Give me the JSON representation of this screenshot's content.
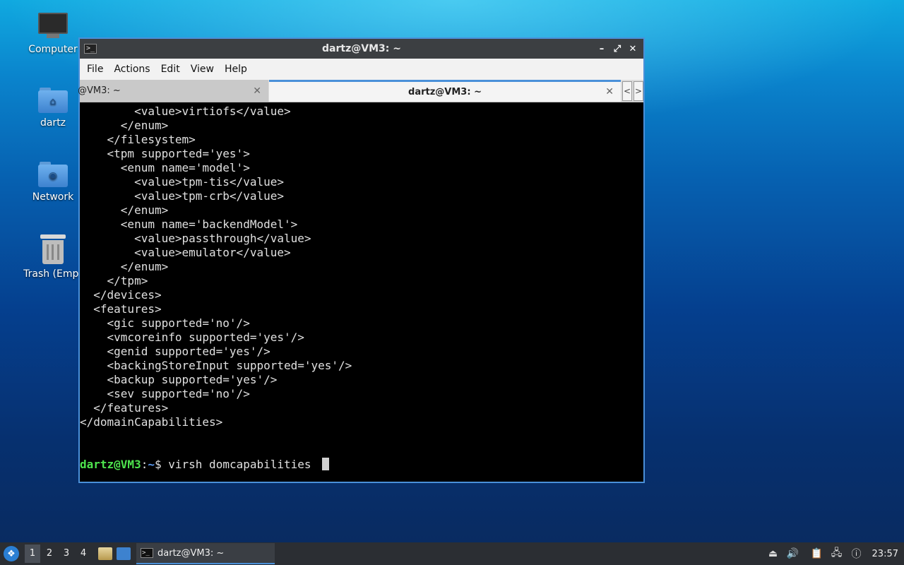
{
  "desktop": {
    "icons": [
      {
        "label": "Computer"
      },
      {
        "label": "dartz"
      },
      {
        "label": "Network"
      },
      {
        "label": "Trash (Empt"
      }
    ]
  },
  "window": {
    "title": "dartz@VM3: ~",
    "controls": {
      "minimize": "–",
      "maximize": "⤢",
      "close": "✕"
    },
    "menu": [
      "File",
      "Actions",
      "Edit",
      "View",
      "Help"
    ],
    "tabs": [
      {
        "label": "@VM3: ~",
        "close": "✕"
      },
      {
        "label": "dartz@VM3: ~",
        "close": "✕"
      }
    ],
    "tab_scroll": {
      "left": "<",
      "right": ">"
    }
  },
  "terminal": {
    "lines": [
      "        <value>virtiofs</value>",
      "      </enum>",
      "    </filesystem>",
      "    <tpm supported='yes'>",
      "      <enum name='model'>",
      "        <value>tpm-tis</value>",
      "        <value>tpm-crb</value>",
      "      </enum>",
      "      <enum name='backendModel'>",
      "        <value>passthrough</value>",
      "        <value>emulator</value>",
      "      </enum>",
      "    </tpm>",
      "  </devices>",
      "  <features>",
      "    <gic supported='no'/>",
      "    <vmcoreinfo supported='yes'/>",
      "    <genid supported='yes'/>",
      "    <backingStoreInput supported='yes'/>",
      "    <backup supported='yes'/>",
      "    <sev supported='no'/>",
      "  </features>",
      "</domainCapabilities>",
      "",
      ""
    ],
    "prompt": {
      "user": "dartz@VM3",
      "sep": ":",
      "path": "~",
      "symbol": "$",
      "command": " virsh domcapabilities "
    }
  },
  "taskbar": {
    "workspaces": [
      "1",
      "2",
      "3",
      "4"
    ],
    "active_workspace": 0,
    "task_label": "dartz@VM3: ~",
    "clock": "23:57"
  }
}
